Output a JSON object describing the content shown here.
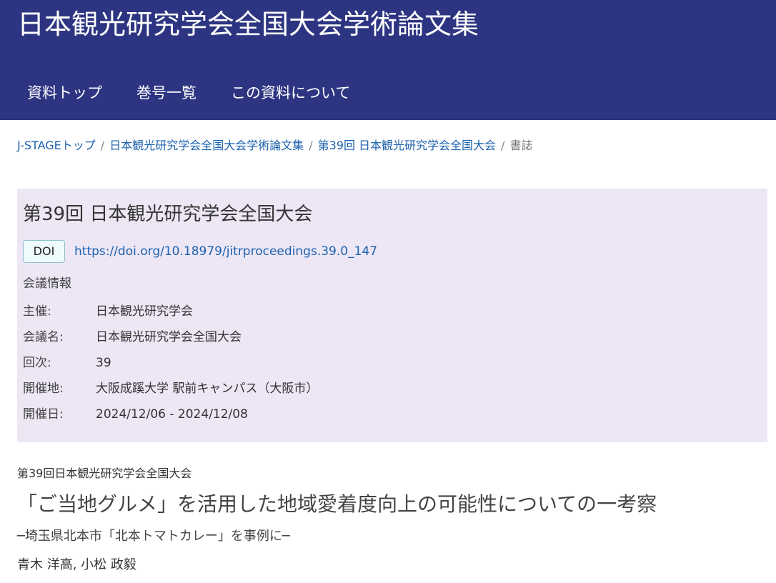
{
  "header": {
    "title": "日本観光研究学会全国大会学術論文集",
    "nav": [
      "資料トップ",
      "巻号一覧",
      "この資料について"
    ]
  },
  "breadcrumb": {
    "items": [
      "J-STAGEトップ",
      "日本観光研究学会全国大会学術論文集",
      "第39回 日本観光研究学会全国大会"
    ],
    "current": "書誌"
  },
  "conference": {
    "title": "第39回 日本観光研究学会全国大会",
    "doi_label": "DOI",
    "doi_url": "https://doi.org/10.18979/jitrproceedings.39.0_147",
    "section_label": "会議情報",
    "meta": [
      {
        "key": "主催:",
        "value": "日本観光研究学会"
      },
      {
        "key": "会議名:",
        "value": "日本観光研究学会全国大会"
      },
      {
        "key": "回次:",
        "value": "39"
      },
      {
        "key": "開催地:",
        "value": "大阪成蹊大学 駅前キャンパス（大阪市）"
      },
      {
        "key": "開催日:",
        "value": "2024/12/06 - 2024/12/08"
      }
    ]
  },
  "article": {
    "conference": "第39回日本観光研究学会全国大会",
    "title": "「ご当地グルメ」を活用した地域愛着度向上の可能性についての一考察",
    "subtitle": "─埼玉県北本市「北本トマトカレー」を事例に─",
    "authors": "青木 洋高, 小松 政毅"
  },
  "colors": {
    "header_bg": "#2d3582",
    "info_box_bg": "#ece6f5",
    "link": "#1d62ae"
  }
}
